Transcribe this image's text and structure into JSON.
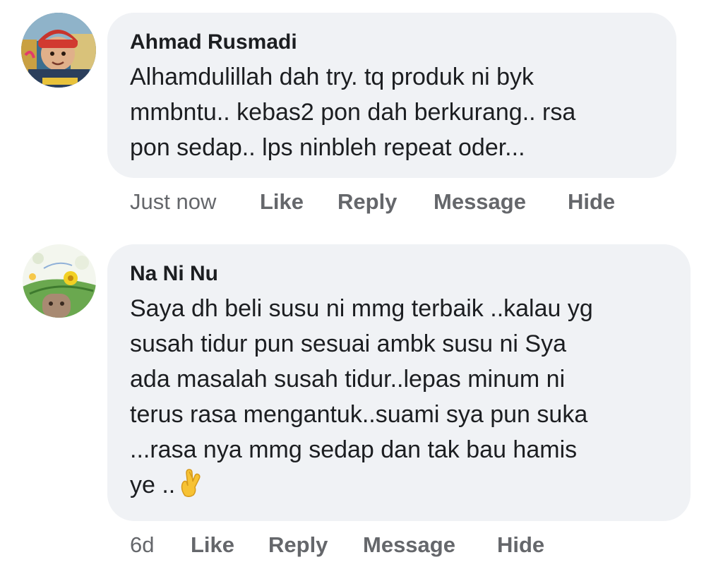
{
  "comments": [
    {
      "author": "Ahmad Rusmadi",
      "lines": [
        "Alhamdulillah dah try. tq produk ni byk",
        "mmbntu.. kebas2 pon dah berkurang.. rsa",
        "pon sedap.. lps ninbleh repeat oder..."
      ],
      "timestamp": "Just now",
      "actions": {
        "like": "Like",
        "reply": "Reply",
        "message": "Message",
        "hide": "Hide"
      }
    },
    {
      "author": "Na Ni Nu",
      "lines": [
        "Saya dh beli susu ni mmg terbaik ..kalau yg",
        "susah tidur pun sesuai ambk susu ni Sya",
        "ada masalah susah tidur..lepas minum ni",
        "terus rasa mengantuk..suami sya pun suka",
        "...rasa nya mmg sedap dan tak bau hamis",
        "ye .."
      ],
      "emoji": "crossed-fingers",
      "timestamp": "6d",
      "actions": {
        "like": "Like",
        "reply": "Reply",
        "message": "Message",
        "hide": "Hide"
      }
    }
  ],
  "colors": {
    "bubble": "#f0f2f5",
    "text": "#1c1e21",
    "secondary": "#65676b"
  }
}
